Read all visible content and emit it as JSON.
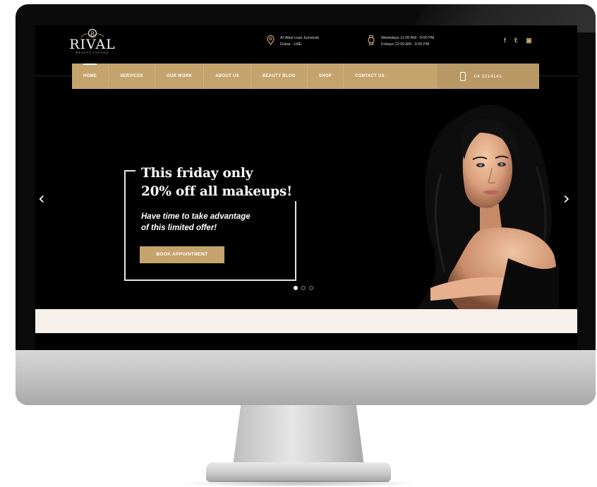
{
  "site": {
    "logo_text": "RIVAL",
    "logo_subtext": "BEAUTY LOUNGE"
  },
  "header": {
    "address_line1": "Al Wasl road Jumeirah",
    "address_line2": "Dubai - UAE",
    "hours_line1": "Weekdays  11:00 AM - 9:00 PM",
    "hours_line2": "Fridays      12:00 AM - 9:00 PM",
    "social": [
      "facebook-icon",
      "twitter-icon",
      "instagram-icon"
    ],
    "social_glyphs": [
      "f",
      "𝕥",
      "▣"
    ]
  },
  "nav": {
    "items": [
      {
        "label": "HOME",
        "active": true
      },
      {
        "label": "SERVICES",
        "active": false
      },
      {
        "label": "OUR WORK",
        "active": false
      },
      {
        "label": "ABOUT US",
        "active": false
      },
      {
        "label": "BEAUTY BLOG",
        "active": false
      },
      {
        "label": "SHOP",
        "active": false
      },
      {
        "label": "CONTACT US",
        "active": false
      }
    ],
    "phone": "04 3214141"
  },
  "hero": {
    "title_line1": "This friday only",
    "title_line2": "20% off all makeups!",
    "desc_line1": "Have time to take advantage",
    "desc_line2": "of this limited offer!",
    "cta": "BOOK APPOINTMENT",
    "slides_total": 3,
    "slide_active": 1
  },
  "colors": {
    "accent_gold": "#c4a36c",
    "background": "#000000",
    "cream": "#f7f0ea"
  }
}
